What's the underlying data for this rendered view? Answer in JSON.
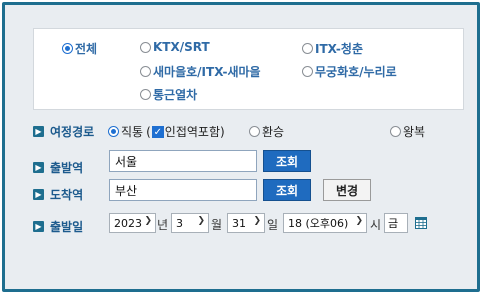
{
  "train_types": [
    {
      "label": "전체",
      "checked": true
    },
    {
      "label": "KTX/SRT",
      "checked": false
    },
    {
      "label": "ITX-청춘",
      "checked": false
    },
    {
      "label": "새마을호/ITX-새마을",
      "checked": false
    },
    {
      "label": "무궁화호/누리로",
      "checked": false
    },
    {
      "label": "통근열차",
      "checked": false
    }
  ],
  "route": {
    "label": "여정경로",
    "direct_label": "직통",
    "paren_open": "(",
    "adjacent_label": "인접역포함",
    "paren_close": ")",
    "transfer_label": "환승",
    "round_trip_label": "왕복"
  },
  "departure": {
    "label": "출발역",
    "value": "서울",
    "search_label": "조회"
  },
  "arrival": {
    "label": "도착역",
    "value": "부산",
    "search_label": "조회",
    "swap_label": "변경"
  },
  "date": {
    "label": "출발일",
    "year": "2023",
    "year_unit": "년",
    "month": "3",
    "month_unit": "월",
    "day": "31",
    "day_unit": "일",
    "hour": "18 (오후06)",
    "hour_unit": "시",
    "weekday": "금"
  },
  "colors": {
    "frame": "#1e6e8f",
    "accent_blue": "#1f6bbf",
    "label_blue": "#1c5a8d"
  }
}
